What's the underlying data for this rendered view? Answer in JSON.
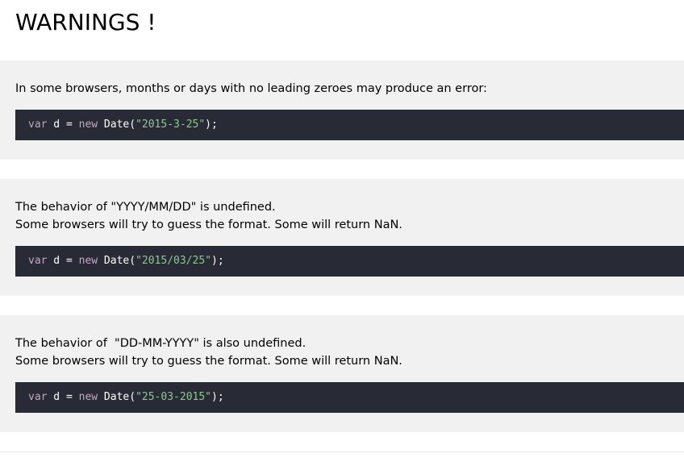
{
  "page": {
    "title": "WARNINGS !"
  },
  "sections": [
    {
      "lines": [
        "In some browsers, months or days with no leading zeroes may produce an error:"
      ],
      "code": {
        "kw1": "var",
        "mid1": " d = ",
        "kw2": "new",
        "mid2": " Date(",
        "string": "\"2015-3-25\"",
        "end": ");"
      }
    },
    {
      "lines": [
        "The behavior of \"YYYY/MM/DD\" is undefined.",
        "Some browsers will try to guess the format. Some will return NaN."
      ],
      "code": {
        "kw1": "var",
        "mid1": " d = ",
        "kw2": "new",
        "mid2": " Date(",
        "string": "\"2015/03/25\"",
        "end": ");"
      }
    },
    {
      "lines": [
        "The behavior of  \"DD-MM-YYYY\" is also undefined.",
        "Some browsers will try to guess the format. Some will return NaN."
      ],
      "code": {
        "kw1": "var",
        "mid1": " d = ",
        "kw2": "new",
        "mid2": " Date(",
        "string": "\"25-03-2015\"",
        "end": ");"
      }
    }
  ],
  "colors": {
    "panel_background": "#f1f1f1",
    "code_background": "#282a35",
    "code_keyword": "#c5a5c5",
    "code_string": "#8dc891",
    "code_text": "#ffffff"
  }
}
